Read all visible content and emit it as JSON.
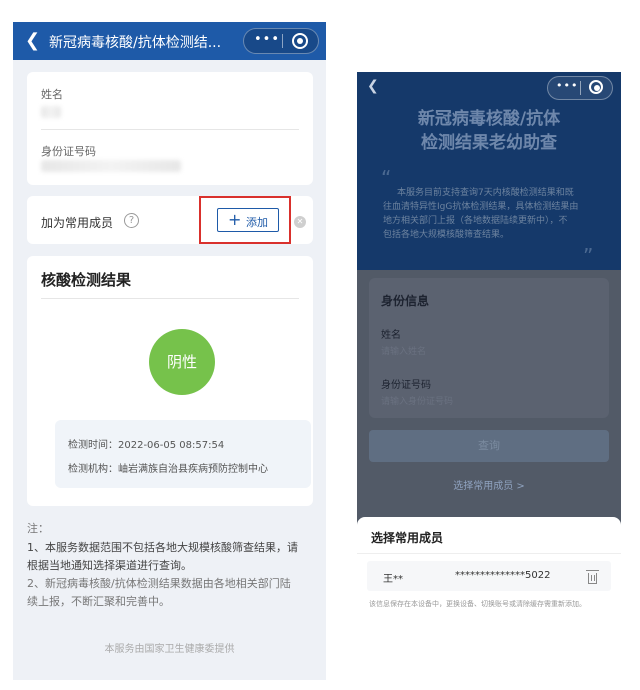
{
  "left": {
    "nav": {
      "back_icon": "chevron-left-icon",
      "title": "新冠病毒核酸/抗体检测结...",
      "more_icon": "more-dots-icon",
      "close_icon": "target-circle-icon"
    },
    "form": {
      "name_label": "姓名",
      "id_label": "身份证号码"
    },
    "member": {
      "label": "加为常用成员",
      "help_icon": "question-icon",
      "add_label": "添加"
    },
    "result": {
      "title": "核酸检测结果",
      "status": "阴性",
      "status_color": "#76c24b",
      "time": "检测时间：2022-06-05 08:57:54",
      "org": "检测机构：岫岩满族自治县疾病预防控制中心"
    },
    "notes": [
      "注：",
      "1、本服务数据范围不包括各地大规模核酸筛查结果，请",
      "根据当地通知选择渠道进行查询。",
      "2、新冠病毒核酸/抗体检测结果数据由各地相关部门陆",
      "续上报，不断汇聚和完善中。"
    ],
    "provider": "本服务由国家卫生健康委提供"
  },
  "right": {
    "banner": {
      "title_line1": "新冠病毒核酸/抗体",
      "title_line2": "检测结果老幼助查",
      "desc": [
        "本服务目前支持查询7天内核酸检测结果和既",
        "往血清特异性IgG抗体检测结果，具体检测结果由",
        "地方相关部门上报（各地数据陆续更新中），不",
        "包括各地大规模核酸筛查结果。"
      ]
    },
    "identity": {
      "title": "身份信息",
      "name_label": "姓名",
      "name_placeholder": "请输入姓名",
      "id_label": "身份证号码",
      "id_placeholder": "请输入身份证号码"
    },
    "query_label": "查询",
    "select_member": "选择常用成员 >",
    "sheet": {
      "title": "选择常用成员",
      "member_name": "王**",
      "member_id": "**************5022",
      "note": "该信息保存在本设备中，更换设备、切换账号或清除缓存需重新添加。"
    }
  },
  "colors": {
    "brand_blue": "#1e5aa8",
    "highlight_red": "#d9302c"
  }
}
